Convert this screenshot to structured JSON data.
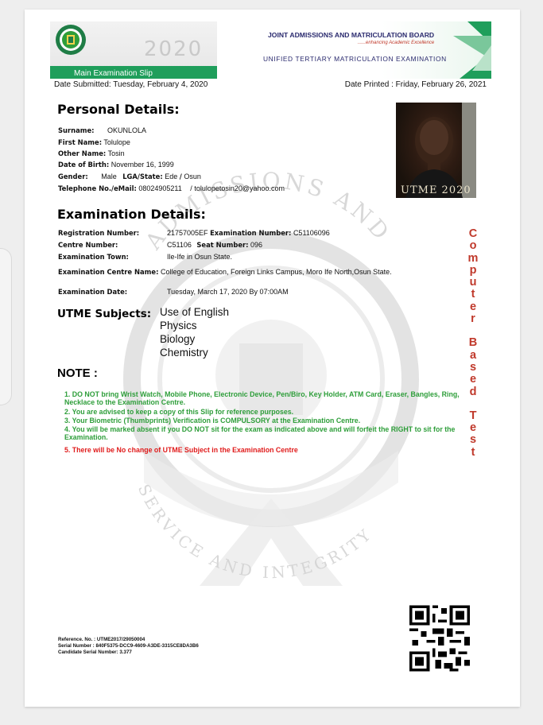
{
  "header": {
    "year": "2020",
    "slip_label": "Main Examination Slip",
    "board_name": "JOINT ADMISSIONS AND MATRICULATION BOARD",
    "motto": "......enhancing Academic Excellence",
    "exam_name": "UNIFIED TERTIARY MATRICULATION EXAMINATION"
  },
  "dates": {
    "submitted": "Date Submitted: Tuesday, February 4, 2020",
    "printed": "Date Printed : Friday, February 26, 2021"
  },
  "personal": {
    "title": "Personal Details:",
    "surname_label": "Surname:",
    "surname": "OKUNLOLA",
    "first_name_label": "First Name:",
    "first_name": "Tolulope",
    "other_name_label": "Other Name:",
    "other_name": "Tosin",
    "dob_label": "Date of Birth:",
    "dob": "November 16, 1999",
    "gender_label": "Gender:",
    "gender": "Male",
    "lga_label": "LGA/State:",
    "lga": "Ede",
    "state": "Osun",
    "contact_label": "Telephone No./eMail:",
    "phone": "08024905211",
    "email": "tolulopetosin20@yahoo.com"
  },
  "photo": {
    "stamp": "UTME 2020"
  },
  "exam": {
    "title": "Examination Details:",
    "reg_label": "Registration Number:",
    "reg_number": "21757005EF",
    "exam_number_label": "Examination Number:",
    "exam_number": "C51106096",
    "centre_label": "Centre Number:",
    "centre_number": "C51106",
    "seat_label": "Seat Number:",
    "seat_number": "096",
    "town_label": "Examination Town:",
    "town": "Ile-Ife in Osun State.",
    "centre_name_label": "Examination Centre Name:",
    "centre_name": "College of Education, Foreign Links Campus, Moro Ife North,Osun State.",
    "date_label": "Examination Date:",
    "date": "Tuesday, March 17, 2020 By 07:00AM"
  },
  "subjects": {
    "title": "UTME Subjects:",
    "items": [
      "Use of English",
      "Physics",
      "Biology",
      "Chemistry"
    ]
  },
  "notes": {
    "title": "NOTE :",
    "items": [
      "1. DO NOT bring Wrist Watch, Mobile Phone, Electronic Device, Pen/Biro, Key Holder, ATM Card, Eraser, Bangles, Ring, Necklace to the Examination Centre.",
      "2. You are advised to keep a copy of this Slip for reference purposes.",
      "3. Your Biometric (Thumbprints) Verification is COMPULSORY at the Examination Centre.",
      "4. You will be marked absent if you DO NOT sit for the exam as indicated above and will forfeit the RIGHT to sit for the Examination.",
      "5. There will be No change of UTME Subject in the Examination Centre"
    ]
  },
  "vertical_text": [
    "C",
    "o",
    "m",
    "p",
    "u",
    "t",
    "e",
    "r",
    "",
    "B",
    "a",
    "s",
    "e",
    "d",
    "",
    "T",
    "e",
    "s",
    "t"
  ],
  "watermark": {
    "top_text": "ADMISSIONS AND",
    "bottom_text": "SERVICE AND INTEGRITY"
  },
  "footer": {
    "reference": "Reference. No. : UTME2017/29050004",
    "serial": "Serial Number  : 840F5375-DCC9-4609-A3DE-3315CE8DA3B6",
    "candidate_serial": "Candidate Serial Number: 3.377"
  },
  "colors": {
    "brand_green": "#1f9e5b",
    "note_green": "#2e9e3a",
    "note_red": "#e01b1b",
    "vertical_red": "#c0392b"
  }
}
